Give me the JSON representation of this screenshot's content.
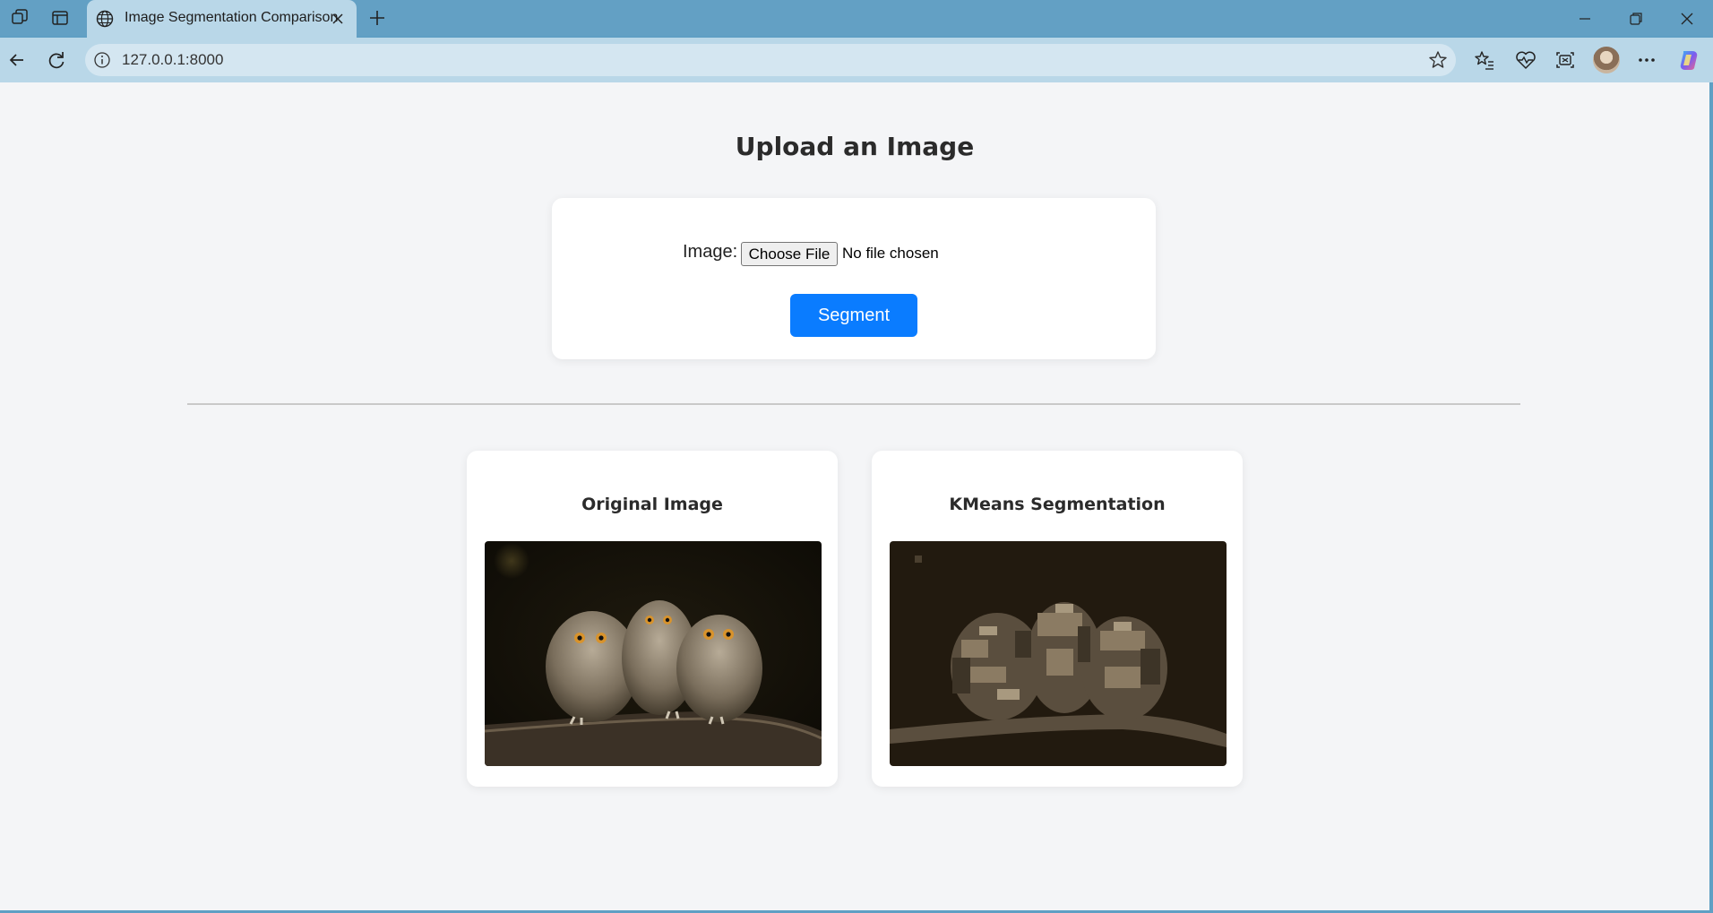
{
  "browser": {
    "tab_title": "Image Segmentation Comparison",
    "url": "127.0.0.1:8000",
    "icons": [
      "workspaces-icon",
      "tab-actions-icon",
      "globe-icon",
      "close-icon",
      "plus-icon",
      "minimize-icon",
      "restore-icon",
      "window-close-icon",
      "back-icon",
      "refresh-icon",
      "info-icon",
      "star-icon",
      "favorites-icon",
      "health-icon",
      "screenshot-icon",
      "profile-avatar",
      "more-icon",
      "copilot-icon"
    ]
  },
  "page": {
    "heading": "Upload an Image",
    "upload": {
      "image_label": "Image:",
      "choose_file_label": "Choose File",
      "file_status": "No file chosen",
      "segment_label": "Segment"
    },
    "results": [
      {
        "title": "Original Image"
      },
      {
        "title": "KMeans Segmentation"
      }
    ]
  },
  "colors": {
    "page_background": "#f4f5f7",
    "primary_button": "#0a7cff",
    "browser_frame": "#63a0c4",
    "toolbar": "#b9d7e8"
  }
}
